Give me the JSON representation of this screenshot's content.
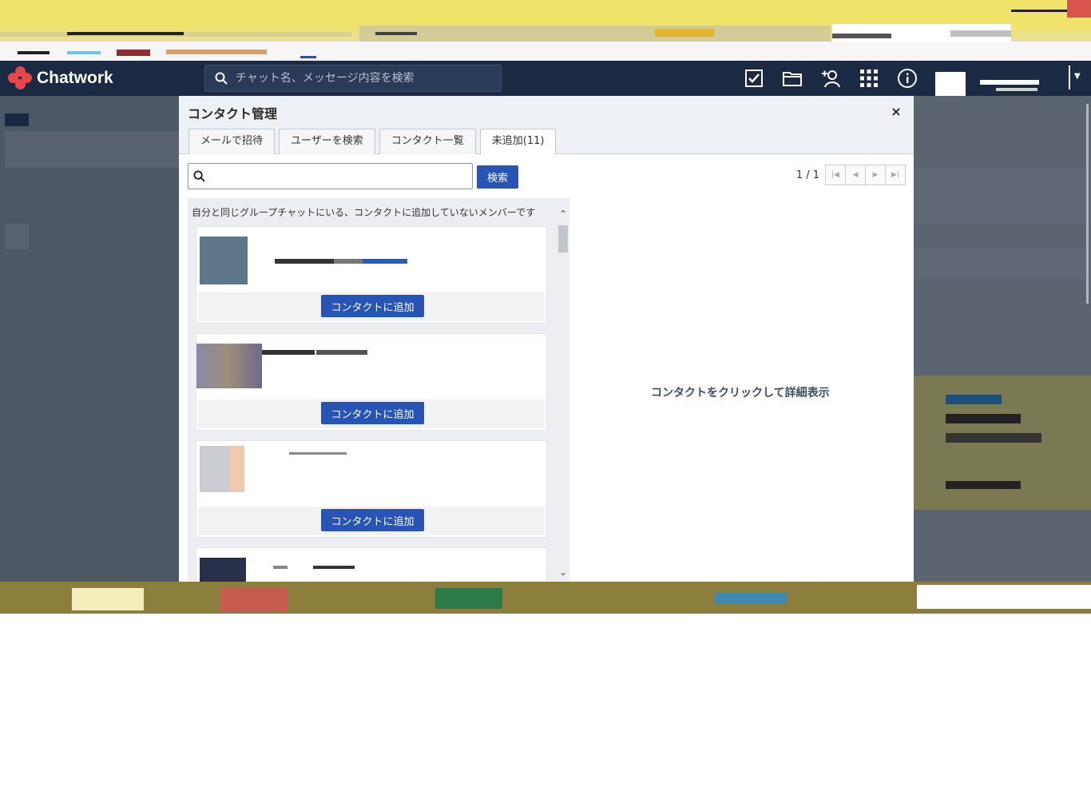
{
  "app": {
    "name": "Chatwork",
    "search_placeholder": "チャット名、メッセージ内容を検索"
  },
  "header_icons": [
    "task-icon",
    "file-icon",
    "contact-add-icon",
    "apps-icon",
    "info-icon"
  ],
  "modal": {
    "title": "コンタクト管理",
    "close": "×",
    "tabs": [
      {
        "label": "メールで招待"
      },
      {
        "label": "ユーザーを検索"
      },
      {
        "label": "コンタクト一覧"
      },
      {
        "label": "未追加(11)"
      }
    ],
    "search": {
      "value": "",
      "button": "検索"
    },
    "pager": {
      "count": "1 / 1"
    },
    "list_description": "自分と同じグループチャットにいる、コンタクトに追加していないメンバーです",
    "cards": [
      {
        "add_label": "コンタクトに追加"
      },
      {
        "add_label": "コンタクトに追加"
      },
      {
        "add_label": "コンタクトに追加"
      },
      {
        "add_label": ""
      }
    ],
    "detail_hint": "コンタクトをクリックして詳細表示"
  },
  "colors": {
    "header_bg": "#1b2a43",
    "accent_button": "#2854b5",
    "logo_red": "#e8474a"
  }
}
